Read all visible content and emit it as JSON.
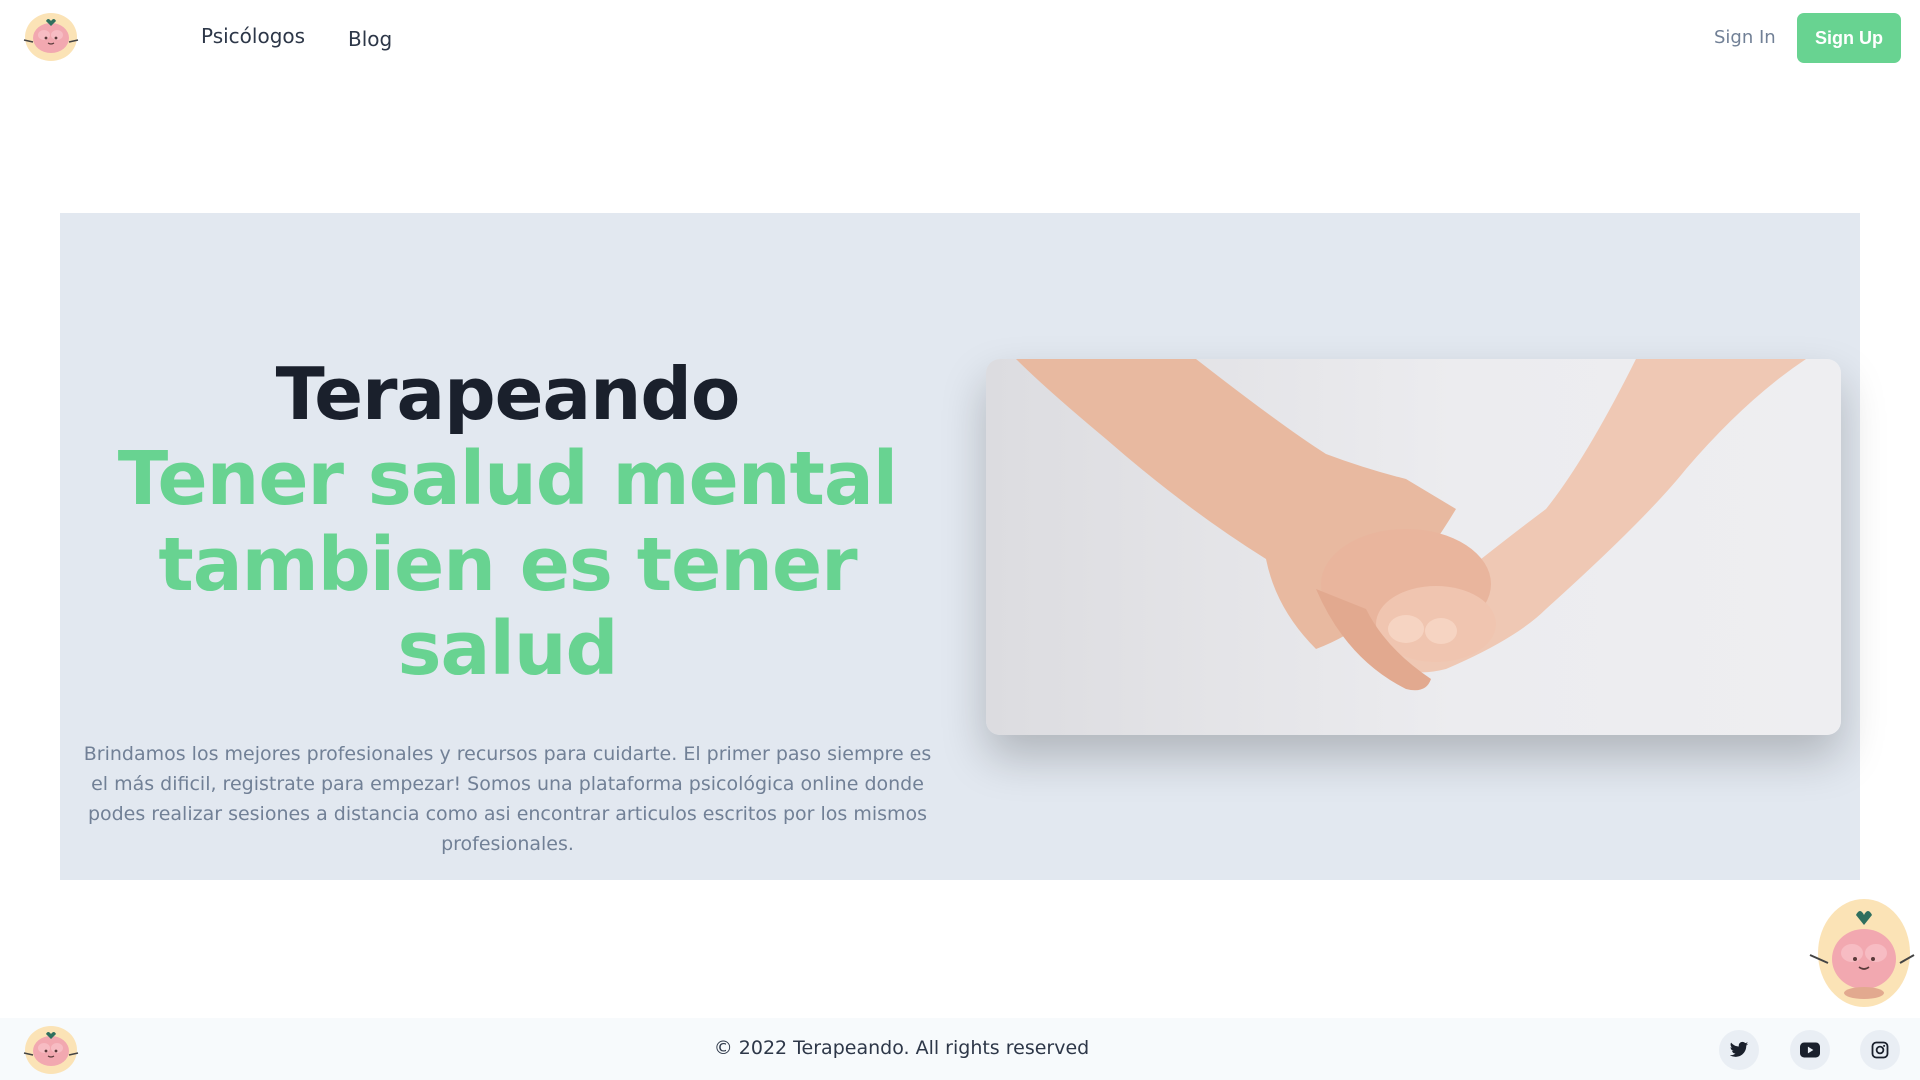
{
  "header": {
    "logo_icon": "brain-mascot-icon",
    "nav": [
      {
        "label": "Psicólogos"
      },
      {
        "label": "Blog"
      }
    ],
    "sign_in": "Sign In",
    "sign_up": "Sign Up"
  },
  "hero": {
    "title": "Terapeando",
    "subtitle_line1": "Tener salud mental",
    "subtitle_line2": "tambien es tener salud",
    "description": "Brindamos los mejores profesionales y recursos para cuidarte. El primer paso siempre es el más dificil, registrate para empezar! Somos una plataforma psicológica online donde podes realizar sesiones a distancia como asi encontrar articulos escritos por los mismos profesionales.",
    "image": "holding-hands-photo"
  },
  "footer": {
    "copyright": "© 2022 Terapeando. All rights reserved",
    "social": [
      "twitter-icon",
      "youtube-icon",
      "instagram-icon"
    ]
  },
  "colors": {
    "accent": "#68d391",
    "hero_bg": "#e2e8f0",
    "heading": "#1a202c",
    "muted_text": "#718096"
  }
}
